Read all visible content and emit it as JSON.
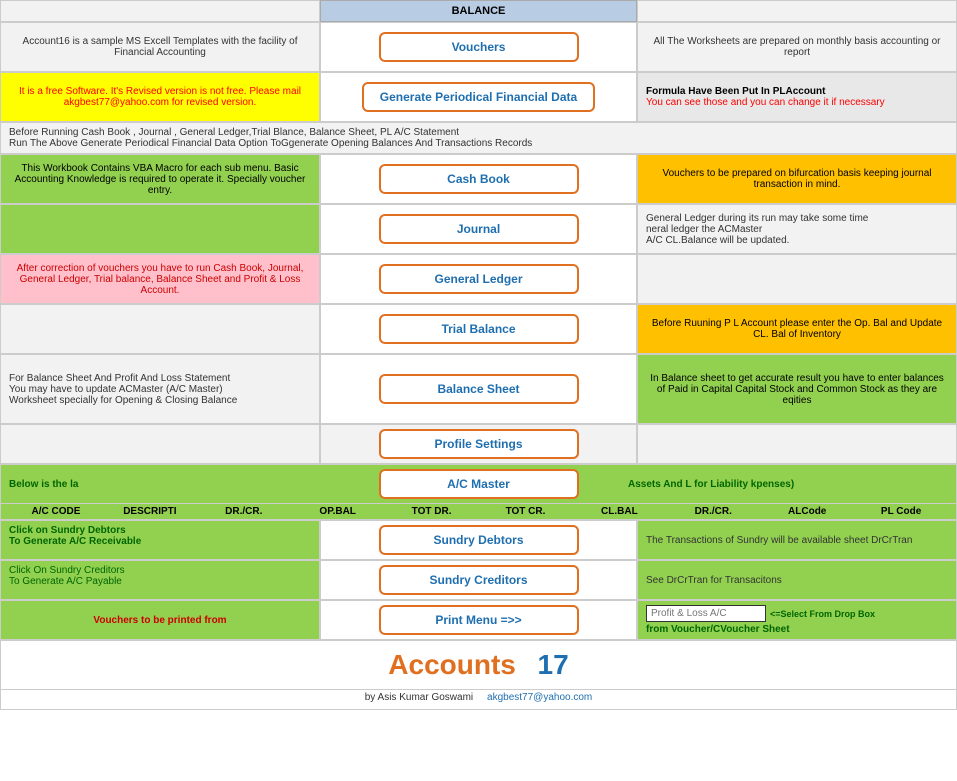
{
  "header": {
    "balance_label": "BALANCE"
  },
  "vouchers_row": {
    "left_text": "Account16 is a sample MS Excell Templates with the facility of Financial Accounting",
    "button_label": "Vouchers",
    "right_text": "All The Worksheets are prepared on monthly basis accounting or report"
  },
  "generate_row": {
    "left_text_line1": "It is a free Software. It's Revised version is not free.  Please mail akgbest77@yahoo.com for revised version.",
    "button_label": "Generate Periodical Financial Data",
    "right_text_line1": "Formula Have Been Put In PLAccount",
    "right_text_line2": "You can see those and you can change it if necessary"
  },
  "notice_row": {
    "line1": "Before Running Cash Book , Journal , General Ledger,Trial Blance, Balance Sheet, PL A/C Statement",
    "line2": "Run The Above Generate Periodical Financial Data Option ToGgenerate Opening Balances And Transactions Records"
  },
  "cashbook_row": {
    "left_text": "This Workbook Contains VBA Macro for each sub menu. Basic Accounting Knowledge is required to operate it. Specially voucher entry.",
    "button_label": "Cash Book",
    "right_text": "Vouchers to be prepared on bifurcation basis keeping journal transaction in mind."
  },
  "journal_row": {
    "button_label": "Journal",
    "right_text_line1": "General Ledger during its run may take some time",
    "right_text_line2": "neral ledger the ACMaster",
    "right_text_line3": "A/C CL.Balance will be updated."
  },
  "general_ledger_row": {
    "left_text_line1": "After correction of vouchers you have to run Cash Book, Journal, General Ledger, Trial balance, Balance Sheet and Profit & Loss Account.",
    "button_label": "General Ledger"
  },
  "trial_balance_row": {
    "button_label": "Trial Balance",
    "right_text": "Before Ruuning P L Account please enter the Op. Bal and Update CL. Bal of Inventory"
  },
  "balance_sheet_row": {
    "left_text_line1": "For Balance Sheet And Profit And Loss Statement",
    "left_text_line2": "You may have to update ACMaster (A/C Master)",
    "left_text_line3": "Worksheet specially for Opening & Closing Balance",
    "button_label": "Balance Sheet",
    "right_text": "In Balance sheet to get accurate result you have to enter balances of Paid in Capital Capital Stock and Common Stock as they are eqities"
  },
  "profile_row": {
    "button_label": "Profile Settings"
  },
  "acmaster_row": {
    "header_left": "Below is the la",
    "button_label": "A/C Master",
    "header_right": "Assets And L for Liability kpenses)",
    "col1": "A/C CODE",
    "col2": "DESCRIPTI",
    "col3": "DR./CR.",
    "col4": "OP.BAL",
    "col5": "TOT DR.",
    "col6": "TOT CR.",
    "col7": "CL.BAL",
    "col8": "DR./CR.",
    "col9": "ALCode",
    "col10": "PL Code"
  },
  "sundry_debtors_row": {
    "left_line1": "Click on Sundry Debtors",
    "left_line2": "To Generate A/C Receivable",
    "button_label": "Sundry Debtors",
    "right_text": "The Transactions of Sundry will be available sheet DrCrTran"
  },
  "sundry_creditors_row": {
    "left_line1": "Click On Sundry Creditors",
    "left_line2": "To Generate A/C Payable",
    "button_label": "Sundry Creditors",
    "right_text": "See DrCrTran for Transacitons"
  },
  "print_row": {
    "left_text": "Vouchers to be printed from",
    "button_label": "Print Menu =>>",
    "right_pl_label": "Profit & Loss A/C",
    "right_dropdown_text": "<=Select From Drop Box",
    "right_bottom_text": "from Voucher/CVoucher Sheet"
  },
  "footer": {
    "accounts_text": "Accounts",
    "accounts_num": "17",
    "sub_line1": "by Asis Kumar Goswami",
    "email": "akgbest77@yahoo.com"
  }
}
